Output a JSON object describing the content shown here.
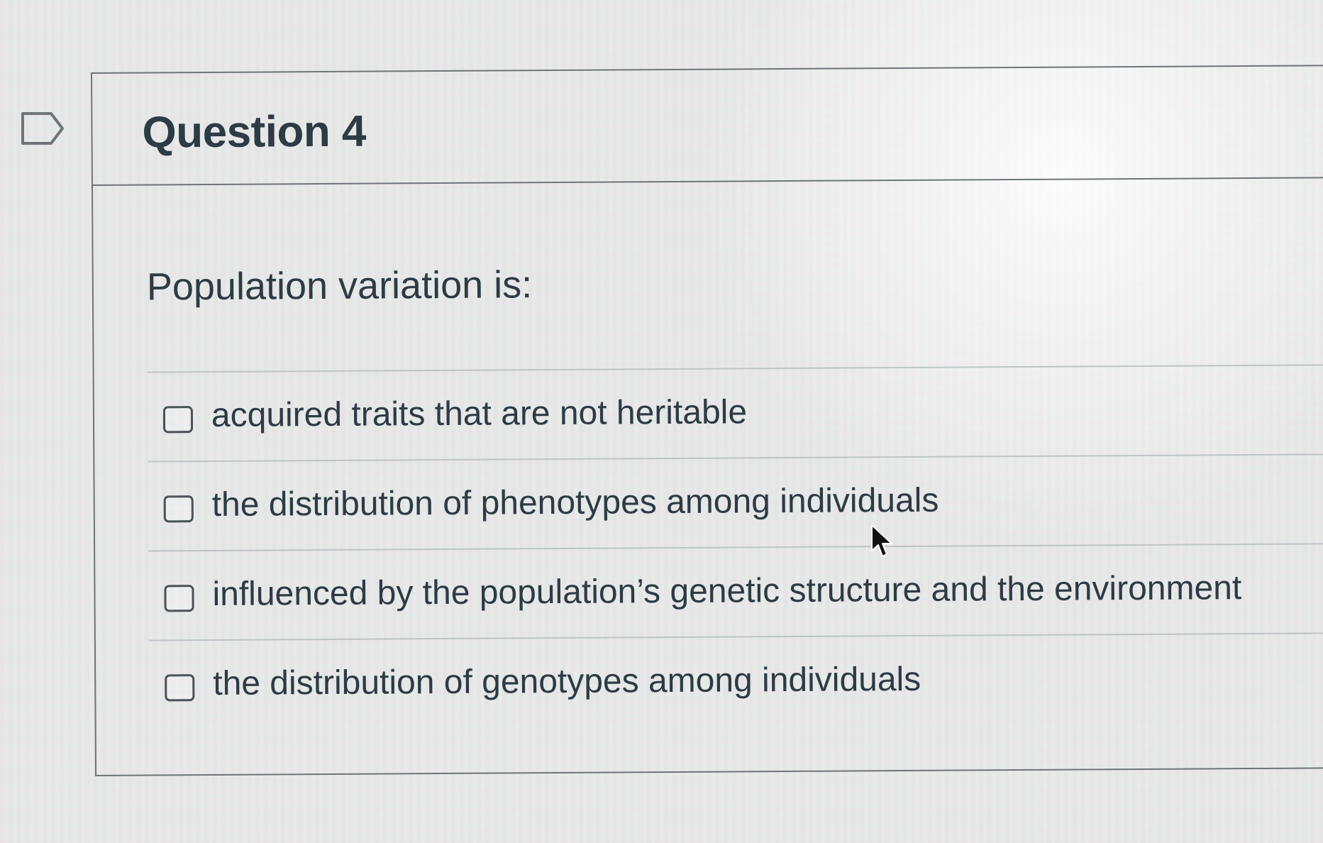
{
  "question": {
    "title": "Question 4",
    "prompt": "Population variation is:",
    "answers": [
      {
        "label": "acquired traits that are not heritable",
        "checked": false
      },
      {
        "label": "the distribution of phenotypes among individuals",
        "checked": false
      },
      {
        "label": "influenced by the population’s genetic structure and the environment",
        "checked": false
      },
      {
        "label": "the distribution of genotypes among individuals",
        "checked": false
      }
    ]
  },
  "icons": {
    "flag": "flag-icon",
    "cursor": "mouse-pointer-icon"
  },
  "colors": {
    "text": "#2d3b45",
    "border": "#6f7478",
    "divider": "#bfc4c6"
  }
}
